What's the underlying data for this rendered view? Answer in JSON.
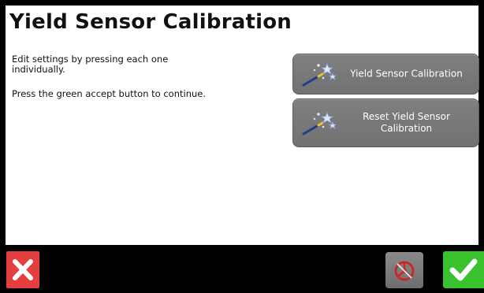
{
  "screen": {
    "title": "Yield Sensor Calibration"
  },
  "instructions": {
    "line1": "Edit settings by pressing each one individually.",
    "line2": "Press the green accept button to continue."
  },
  "buttons": {
    "yield_calibration": {
      "label": "Yield Sensor Calibration",
      "icon": "wand-icon"
    },
    "reset_calibration": {
      "label": "Reset Yield Sensor Calibration",
      "icon": "wand-icon"
    }
  },
  "bottom_bar": {
    "cancel_icon": "close-icon",
    "steering_icon": "steering-wheel-disabled-icon",
    "accept_icon": "checkmark-icon"
  },
  "colors": {
    "cancel": "#e53e3e",
    "accept": "#39c12e",
    "button": "#7a7a7a"
  }
}
